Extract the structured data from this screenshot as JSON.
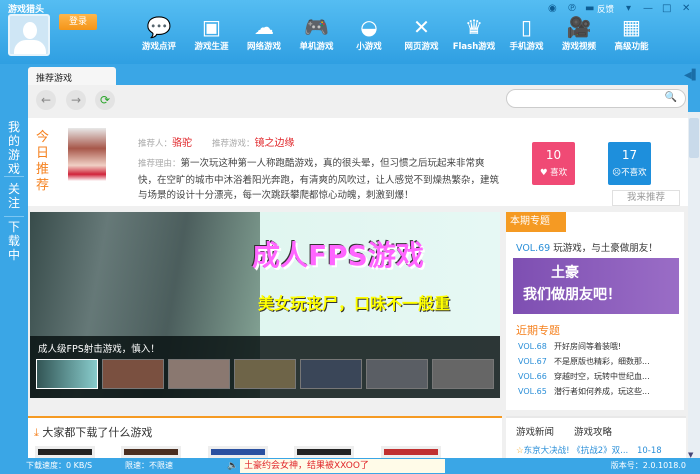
{
  "app": {
    "title": "游戏猎头",
    "login": "登录"
  },
  "nav": [
    {
      "icon": "chat-bubbles-icon",
      "glyph": "💬",
      "label": "游戏点评"
    },
    {
      "icon": "book-icon",
      "glyph": "▣",
      "label": "游戏生涯"
    },
    {
      "icon": "cloud-icon",
      "glyph": "☁",
      "label": "网络游戏"
    },
    {
      "icon": "gamepad-icon",
      "glyph": "🎮",
      "label": "单机游戏"
    },
    {
      "icon": "mario-cap-icon",
      "glyph": "◒",
      "label": "小游戏"
    },
    {
      "icon": "crossed-swords-icon",
      "glyph": "✕",
      "label": "网页游戏"
    },
    {
      "icon": "crown-icon",
      "glyph": "♛",
      "label": "Flash游戏"
    },
    {
      "icon": "phone-icon",
      "glyph": "▯",
      "label": "手机游戏"
    },
    {
      "icon": "video-camera-icon",
      "glyph": "🎥",
      "label": "游戏视频"
    },
    {
      "icon": "cube-icon",
      "glyph": "▦",
      "label": "高级功能"
    }
  ],
  "window": {
    "feedback": "反馈"
  },
  "sidebar": {
    "my_games": "我的游戏",
    "follow": "关注",
    "downloading": "下载中"
  },
  "tab": "推荐游戏",
  "recommend": {
    "heading": "今日推荐",
    "recommender_label": "推荐人：",
    "recommender": "骆驼",
    "game_label": "推荐游戏：",
    "game": "镜之边缘",
    "reason_label": "推荐理由：",
    "reason": "第一次玩这种第一人称跑酷游戏，真的很头晕，但习惯之后玩起来非常爽快，在空旷的城市中沐浴着阳光奔跑，有清爽的风吹过，让人感觉不到燥热繁杂，建筑与场景的设计十分漂亮，每一次跳跃攀爬都惊心动魄，刺激到爆！",
    "like_count": "10",
    "like": "喜欢",
    "dislike_count": "17",
    "dislike": "不喜欢",
    "recommend_btn": "我来推荐"
  },
  "banner": {
    "title": "成人FPS游戏",
    "subtitle": "美女玩丧尸，口味不一般重",
    "caption": "成人级FPS射击游戏，慎入！"
  },
  "topic": {
    "header": "本期专题",
    "vol": "VOL.69",
    "title": "玩游戏，与土豪做朋友！",
    "promo_line1": "土豪",
    "promo_line2": "我们做朋友吧！",
    "recent_header": "近期专题",
    "recent": [
      {
        "vol": "VOL.68",
        "title": "开好房间等着装哦!"
      },
      {
        "vol": "VOL.67",
        "title": "不是原版也精彩，细数那..."
      },
      {
        "vol": "VOL.66",
        "title": "穿越时空，玩转中世纪血..."
      },
      {
        "vol": "VOL.65",
        "title": "潜行者如何养成，玩这些..."
      }
    ]
  },
  "downloads": {
    "title": "大家都下载了什么游戏"
  },
  "news": {
    "tabs": [
      "游戏新闻",
      "游戏攻略"
    ],
    "item": "东京大决战!  《抗战2》双...",
    "date": "10-18"
  },
  "status": {
    "speed": "下载速度：0 KB/S",
    "limit": "限速：不限速",
    "ticker": "土豪约会女神，结果被XXOO了",
    "version": "版本号：2.0.1018.0"
  }
}
